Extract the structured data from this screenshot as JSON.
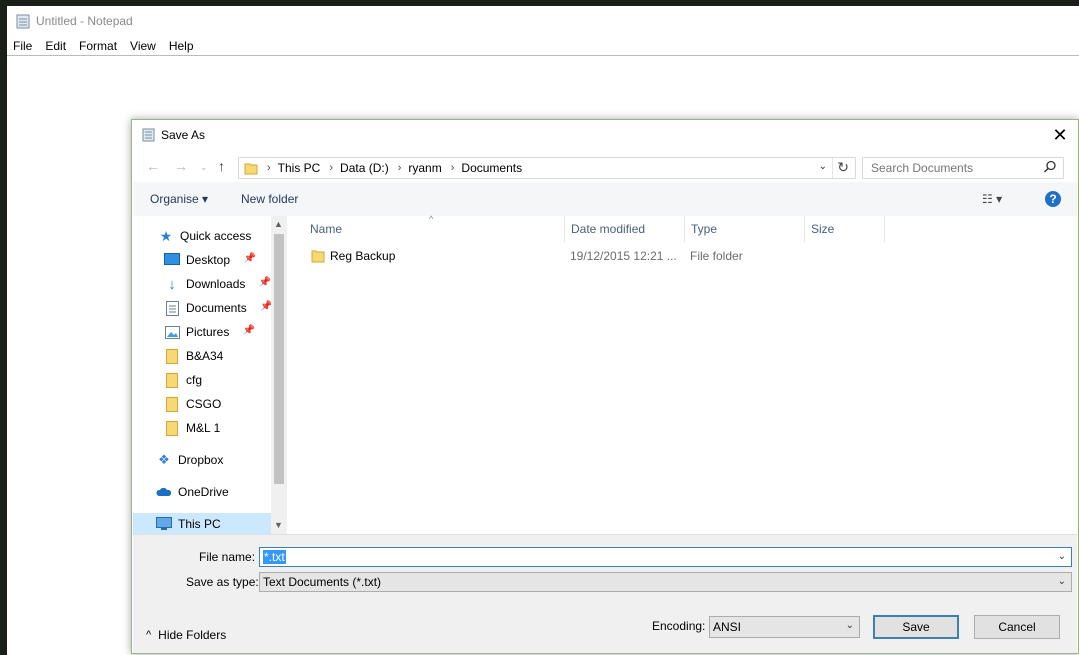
{
  "notepad": {
    "title": "Untitled - Notepad",
    "menu": [
      "File",
      "Edit",
      "Format",
      "View",
      "Help"
    ]
  },
  "dialog": {
    "title": "Save As",
    "breadcrumb": [
      "This PC",
      "Data (D:)",
      "ryanm",
      "Documents"
    ],
    "search_placeholder": "Search Documents",
    "toolbar": {
      "organise": "Organise ▾",
      "new_folder": "New folder"
    },
    "nav": {
      "quick_access": "Quick access",
      "pinned": [
        "Desktop",
        "Downloads",
        "Documents",
        "Pictures"
      ],
      "folders": [
        "B&A34",
        "cfg",
        "CSGO",
        "M&L 1"
      ],
      "dropbox": "Dropbox",
      "onedrive": "OneDrive",
      "this_pc": "This PC"
    },
    "columns": {
      "name": "Name",
      "date": "Date modified",
      "type": "Type",
      "size": "Size"
    },
    "files": [
      {
        "name": "Reg Backup",
        "date": "19/12/2015 12:21 ...",
        "type": "File folder"
      }
    ],
    "file_name_label": "File name:",
    "file_name_value": "*.txt",
    "save_as_type_label": "Save as type:",
    "save_as_type_value": "Text Documents (*.txt)",
    "encoding_label": "Encoding:",
    "encoding_value": "ANSI",
    "save_label": "Save",
    "cancel_label": "Cancel",
    "hide_folders_label": "Hide Folders"
  }
}
